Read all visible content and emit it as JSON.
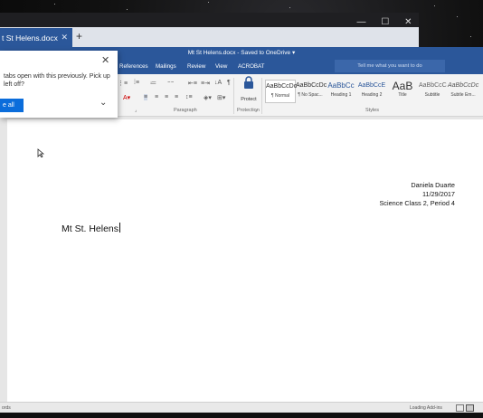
{
  "browser": {
    "tab_title": "t St Helens.docx",
    "tab_close": "✕",
    "new_tab": "+",
    "window_controls": [
      "—",
      "☐",
      "✕"
    ]
  },
  "word": {
    "title": "Mt St Helens.docx - Saved to OneDrive ▾",
    "menu": [
      "References",
      "Mailings",
      "Review",
      "View",
      "ACROBAT"
    ],
    "tell_me": "Tell me what you want to do",
    "groups": {
      "paragraph": "Paragraph",
      "protection": "Protection",
      "styles": "Styles",
      "protect_button": "Protect"
    },
    "styles": [
      {
        "preview": "AaBbCcDc",
        "name": "¶ Normal"
      },
      {
        "preview": "AaBbCcDc",
        "name": "¶ No Spac..."
      },
      {
        "preview": "AaBbCc",
        "name": "Heading 1"
      },
      {
        "preview": "AaBbCcE",
        "name": "Heading 2"
      },
      {
        "preview": "AaB",
        "name": "Title"
      },
      {
        "preview": "AaBbCcC",
        "name": "Subtitle"
      },
      {
        "preview": "AaBbCcDc",
        "name": "Subtle Em..."
      }
    ]
  },
  "popup": {
    "message": "tabs open with this previously. Pick up left off?",
    "button": "e all",
    "close": "✕",
    "chevron": "⌄"
  },
  "document": {
    "name": "Daniela Duarte",
    "date": "11/29/2017",
    "class": "Science Class 2, Period 4",
    "title": "Mt St. Helens"
  },
  "status": {
    "left": "ords",
    "loading": "Loading Add-ins"
  },
  "colors": {
    "accent": "#2b579a",
    "popup_button": "#0b6ddb"
  }
}
